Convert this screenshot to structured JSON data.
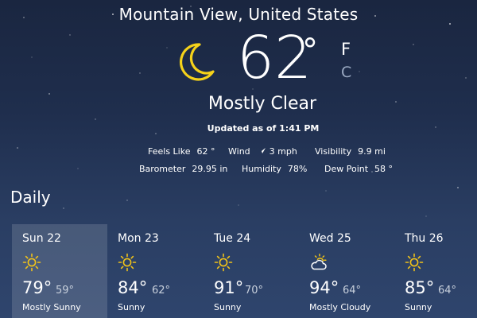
{
  "location": "Mountain View, United States",
  "current": {
    "icon": "moon-icon",
    "temperature": "62",
    "degree_symbol": "°",
    "unit_f": "F",
    "unit_c": "C",
    "condition": "Mostly Clear",
    "updated": "Updated as of 1:41 PM"
  },
  "details": {
    "feels_like": {
      "label": "Feels Like",
      "value": "62 °"
    },
    "wind": {
      "label": "Wind",
      "value": "3 mph"
    },
    "visibility": {
      "label": "Visibility",
      "value": "9.9 mi"
    },
    "barometer": {
      "label": "Barometer",
      "value": "29.95 in"
    },
    "humidity": {
      "label": "Humidity",
      "value": "78%"
    },
    "dew_point": {
      "label": "Dew Point",
      "value": "58 °"
    }
  },
  "daily_title": "Daily",
  "days": [
    {
      "name": "Sun 22",
      "icon": "sun-icon",
      "high": "79°",
      "low": "59°",
      "condition": "Mostly Sunny",
      "selected": true
    },
    {
      "name": "Mon 23",
      "icon": "sun-icon",
      "high": "84°",
      "low": "62°",
      "condition": "Sunny"
    },
    {
      "name": "Tue 24",
      "icon": "sun-icon",
      "high": "91°",
      "low": "70°",
      "condition": "Sunny"
    },
    {
      "name": "Wed 25",
      "icon": "partly-cloudy-icon",
      "high": "94°",
      "low": "64°",
      "condition": "Mostly Cloudy"
    },
    {
      "name": "Thu 26",
      "icon": "sun-icon",
      "high": "85°",
      "low": "64°",
      "condition": "Sunny"
    }
  ],
  "colors": {
    "sun_yellow": "#f2c318",
    "moon_yellow": "#f5d21a",
    "selected_tile": "rgba(255,255,255,0.14)"
  }
}
